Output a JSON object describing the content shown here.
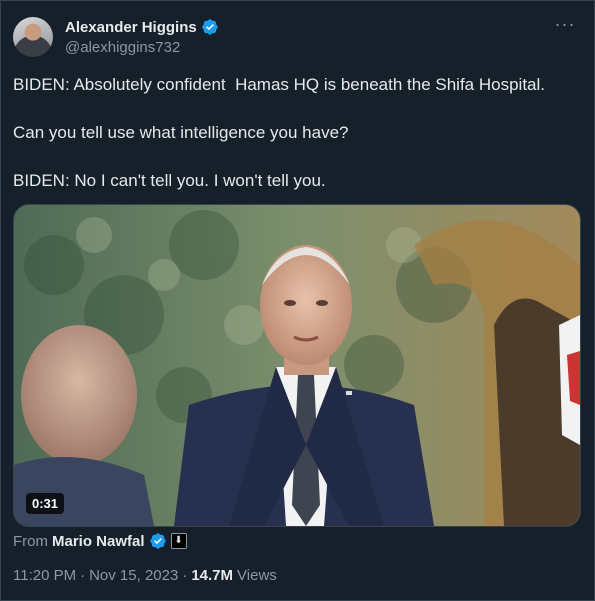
{
  "author": {
    "display_name": "Alexander Higgins",
    "handle": "@alexhiggins732",
    "avatar_icon": "user-avatar-photo",
    "verified_icon": "verified-badge-icon"
  },
  "more_icon": "more-options-icon",
  "more_glyph": "···",
  "tweet_text": [
    "BIDEN: Absolutely confident  Hamas HQ is beneath the Shifa Hospital.",
    "Can you tell use what intelligence you have?",
    "BIDEN: No I can't tell you. I won't tell you."
  ],
  "media": {
    "type": "video",
    "duration": "0:31"
  },
  "source": {
    "label": "From",
    "name": "Mario Nawfal",
    "affiliate_badge": "affiliate-badge-icon",
    "affiliate_glyph": "⬇"
  },
  "meta": {
    "time": "11:20 PM",
    "sep1": "·",
    "date": "Nov 15, 2023",
    "sep2": "·",
    "views_count": "14.7M",
    "views_label": "Views"
  },
  "colors": {
    "background": "#15202b",
    "text": "#e7e9ea",
    "secondary": "#8b98a5",
    "verified": "#1d9bf0",
    "border": "#38444d"
  }
}
